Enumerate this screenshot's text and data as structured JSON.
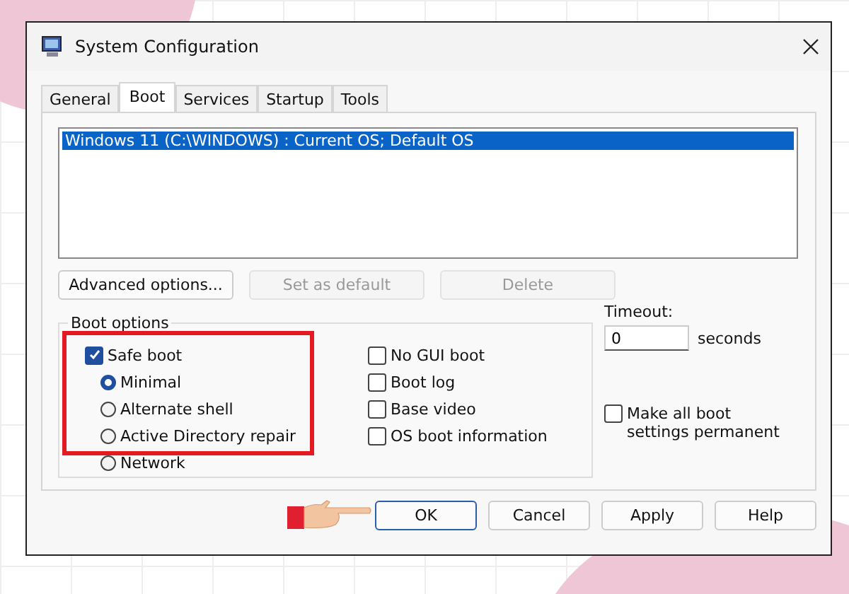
{
  "window": {
    "title": "System Configuration"
  },
  "tabs": [
    {
      "label": "General",
      "selected": false
    },
    {
      "label": "Boot",
      "selected": true
    },
    {
      "label": "Services",
      "selected": false
    },
    {
      "label": "Startup",
      "selected": false
    },
    {
      "label": "Tools",
      "selected": false
    }
  ],
  "boot_entries": [
    {
      "label": "Windows 11 (C:\\WINDOWS) : Current OS; Default OS",
      "selected": true
    }
  ],
  "entry_buttons": [
    {
      "label": "Advanced options...",
      "disabled": false
    },
    {
      "label": "Set as default",
      "disabled": true
    },
    {
      "label": "Delete",
      "disabled": true
    }
  ],
  "boot_options": {
    "title": "Boot options",
    "safe_boot": {
      "label": "Safe boot",
      "checked": true
    },
    "modes": [
      {
        "label": "Minimal",
        "selected": true
      },
      {
        "label": "Alternate shell",
        "selected": false
      },
      {
        "label": "Active Directory repair",
        "selected": false
      },
      {
        "label": "Network",
        "selected": false
      }
    ],
    "flags": [
      {
        "label": "No GUI boot",
        "checked": false
      },
      {
        "label": "Boot log",
        "checked": false
      },
      {
        "label": "Base video",
        "checked": false
      },
      {
        "label": "OS boot information",
        "checked": false
      }
    ]
  },
  "timeout": {
    "label": "Timeout:",
    "value": "0",
    "unit": "seconds"
  },
  "make_permanent": {
    "label": "Make all boot settings permanent",
    "checked": false
  },
  "footer_buttons": [
    {
      "label": "OK",
      "default": true
    },
    {
      "label": "Cancel",
      "default": false
    },
    {
      "label": "Apply",
      "default": false
    },
    {
      "label": "Help",
      "default": false
    }
  ]
}
